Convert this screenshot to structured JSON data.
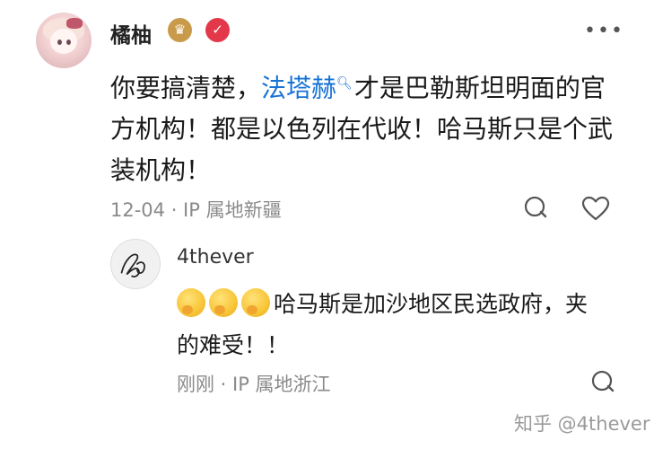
{
  "comment": {
    "username": "橘柚",
    "text_before": "你要搞清楚，",
    "topic_link": "法塔赫",
    "text_after": "才是巴勒斯坦明面的官方机构！都是以色列在代收！哈马斯只是个武装机构！",
    "meta": "12-04 · IP 属地新疆",
    "more_label": "•••"
  },
  "reply": {
    "username": "4thever",
    "text": "哈马斯是加沙地区民选政府，夹的难受！！",
    "emoji_count": 3,
    "emoji_name": "thinking-face",
    "meta": "刚刚 · IP 属地浙江"
  },
  "watermark": "知乎 @4thever",
  "icons": {
    "crown_badge": "crown-icon",
    "verified_badge": "check-circle-icon",
    "reply": "comment-bubble-icon",
    "like": "heart-icon",
    "topic_search": "search-icon"
  },
  "colors": {
    "link": "#1772d4",
    "meta": "#8a8a8a",
    "crown_badge": "#c99a4a",
    "verified_badge": "#e3384a"
  }
}
